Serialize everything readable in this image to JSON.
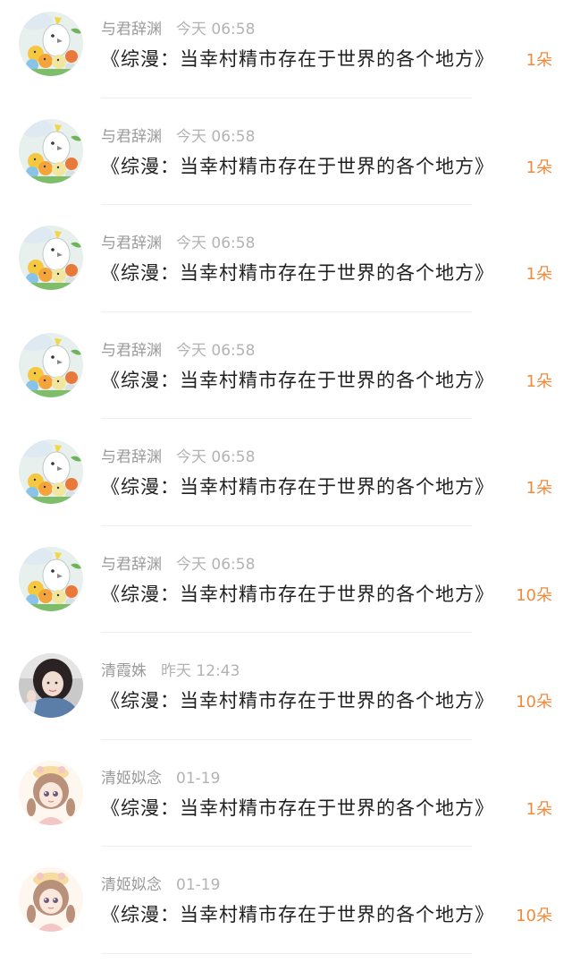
{
  "items": [
    {
      "avatar": "bird-cartoon-avatar",
      "user": "与君辞渊",
      "time": "今天 06:58",
      "title": "《综漫：当幸村精市存在于世界的各个地方》",
      "count": "1朵"
    },
    {
      "avatar": "bird-cartoon-avatar",
      "user": "与君辞渊",
      "time": "今天 06:58",
      "title": "《综漫：当幸村精市存在于世界的各个地方》",
      "count": "1朵"
    },
    {
      "avatar": "bird-cartoon-avatar",
      "user": "与君辞渊",
      "time": "今天 06:58",
      "title": "《综漫：当幸村精市存在于世界的各个地方》",
      "count": "1朵"
    },
    {
      "avatar": "bird-cartoon-avatar",
      "user": "与君辞渊",
      "time": "今天 06:58",
      "title": "《综漫：当幸村精市存在于世界的各个地方》",
      "count": "1朵"
    },
    {
      "avatar": "bird-cartoon-avatar",
      "user": "与君辞渊",
      "time": "今天 06:58",
      "title": "《综漫：当幸村精市存在于世界的各个地方》",
      "count": "1朵"
    },
    {
      "avatar": "bird-cartoon-avatar",
      "user": "与君辞渊",
      "time": "今天 06:58",
      "title": "《综漫：当幸村精市存在于世界的各个地方》",
      "count": "10朵"
    },
    {
      "avatar": "girl-photo-avatar",
      "user": "清霞姝",
      "time": "昨天 12:43",
      "title": "《综漫：当幸村精市存在于世界的各个地方》",
      "count": "10朵"
    },
    {
      "avatar": "anime-girl-avatar",
      "user": "清姬姒念",
      "time": "01-19",
      "title": "《综漫：当幸村精市存在于世界的各个地方》",
      "count": "1朵"
    },
    {
      "avatar": "anime-girl-avatar",
      "user": "清姬姒念",
      "time": "01-19",
      "title": "《综漫：当幸村精市存在于世界的各个地方》",
      "count": "10朵"
    }
  ],
  "colors": {
    "count": "#f08a3c",
    "meta": "#9a9a9a",
    "title": "#1f1f1f"
  }
}
